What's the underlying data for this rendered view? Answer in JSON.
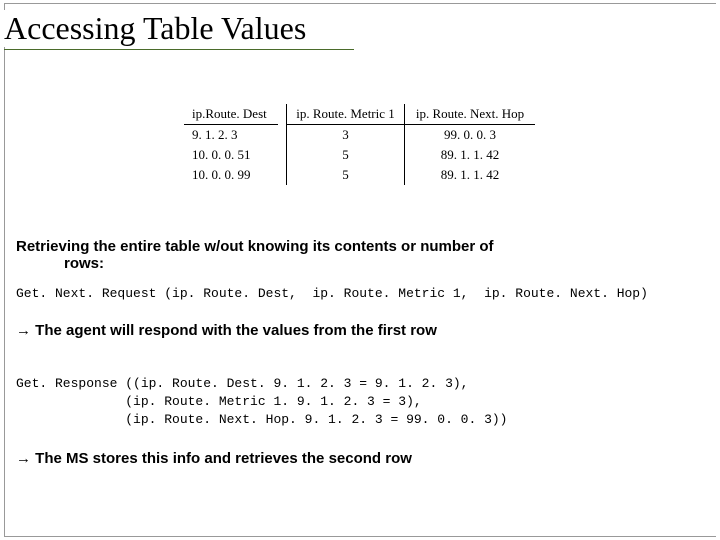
{
  "title": "Accessing Table Values",
  "table": {
    "headers": {
      "dest": "ip.Route. Dest",
      "metric": "ip. Route. Metric 1",
      "next": "ip. Route. Next. Hop"
    },
    "rows": [
      {
        "dest": "9. 1. 2. 3",
        "metric": "3",
        "next": "99. 0. 0. 3"
      },
      {
        "dest": "10. 0. 0. 51",
        "metric": "5",
        "next": "89. 1. 1. 42"
      },
      {
        "dest": "10. 0. 0. 99",
        "metric": "5",
        "next": "89. 1. 1. 42"
      }
    ]
  },
  "para1_line1": "Retrieving the entire table w/out knowing its contents or number of",
  "para1_line2": "rows:",
  "request_line": "Get. Next. Request (ip. Route. Dest,  ip. Route. Metric 1,  ip. Route. Next. Hop)",
  "arrow": "→",
  "arrow1_text": " The agent will respond with the values from the first row",
  "response_l1": "Get. Response ((ip. Route. Dest. 9. 1. 2. 3 = 9. 1. 2. 3),",
  "response_l2": "              (ip. Route. Metric 1. 9. 1. 2. 3 = 3),",
  "response_l3": "              (ip. Route. Next. Hop. 9. 1. 2. 3 = 99. 0. 0. 3))",
  "arrow2_text": " The MS stores this info and retrieves the second row",
  "chart_data": {
    "type": "table",
    "columns": [
      "ip.Route.Dest",
      "ip.Route.Metric1",
      "ip.Route.Next.Hop"
    ],
    "rows": [
      [
        "9.1.2.3",
        3,
        "99.0.0.3"
      ],
      [
        "10.0.0.51",
        5,
        "89.1.1.42"
      ],
      [
        "10.0.0.99",
        5,
        "89.1.1.42"
      ]
    ]
  }
}
